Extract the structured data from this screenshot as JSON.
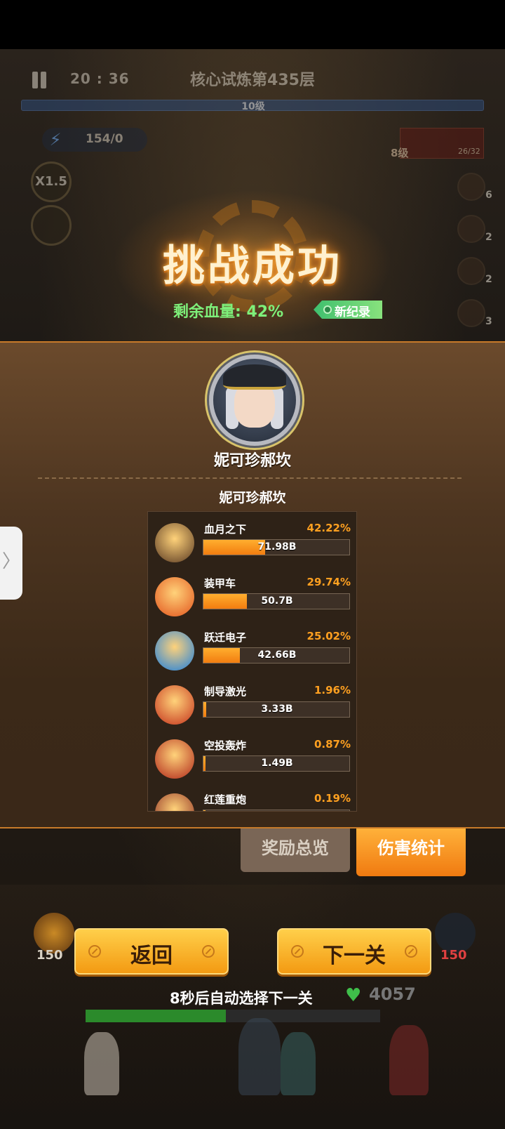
{
  "hud": {
    "timer": "20 : 36",
    "stage_title": "核心试炼第435层",
    "level_label": "10级",
    "energy": "154/0",
    "speed": "X1.5",
    "weapon_level": "8级",
    "weapon_count": "26/32",
    "side_skills": [
      "6",
      "2",
      "2",
      "3"
    ]
  },
  "result": {
    "title": "挑战成功",
    "remaining_hp": "剩余血量: 42%",
    "record_badge": "新纪录"
  },
  "hero": {
    "name_main": "妮可珍郝坎",
    "name_sub": "妮可珍郝坎"
  },
  "damage_stats": [
    {
      "name": "血月之下",
      "percent": "42.22%",
      "value": "71.98B",
      "ratio": 0.4222,
      "icon": "rifle-icon",
      "color": "#5a3a22"
    },
    {
      "name": "装甲车",
      "percent": "29.74%",
      "value": "50.7B",
      "ratio": 0.2974,
      "icon": "armored-car-icon",
      "color": "#e2541c"
    },
    {
      "name": "跃迁电子",
      "percent": "25.02%",
      "value": "42.66B",
      "ratio": 0.2502,
      "icon": "electron-icon",
      "color": "#1c7fe0"
    },
    {
      "name": "制导激光",
      "percent": "1.96%",
      "value": "3.33B",
      "ratio": 0.0196,
      "icon": "laser-icon",
      "color": "#c4321c"
    },
    {
      "name": "空投轰炸",
      "percent": "0.87%",
      "value": "1.49B",
      "ratio": 0.0087,
      "icon": "airstrike-icon",
      "color": "#b0281a"
    },
    {
      "name": "红莲重炮",
      "percent": "0.19%",
      "value": "",
      "ratio": 0.0019,
      "icon": "cannon-icon",
      "color": "#8a2a20"
    }
  ],
  "tabs": {
    "rewards": "奖励总览",
    "damage": "伤害统计"
  },
  "actions": {
    "back": "返回",
    "next": "下一关"
  },
  "footer": {
    "auto_next": "8秒后自动选择下一关",
    "heart_value": "4057",
    "power_left": "150",
    "power_right": "150"
  }
}
